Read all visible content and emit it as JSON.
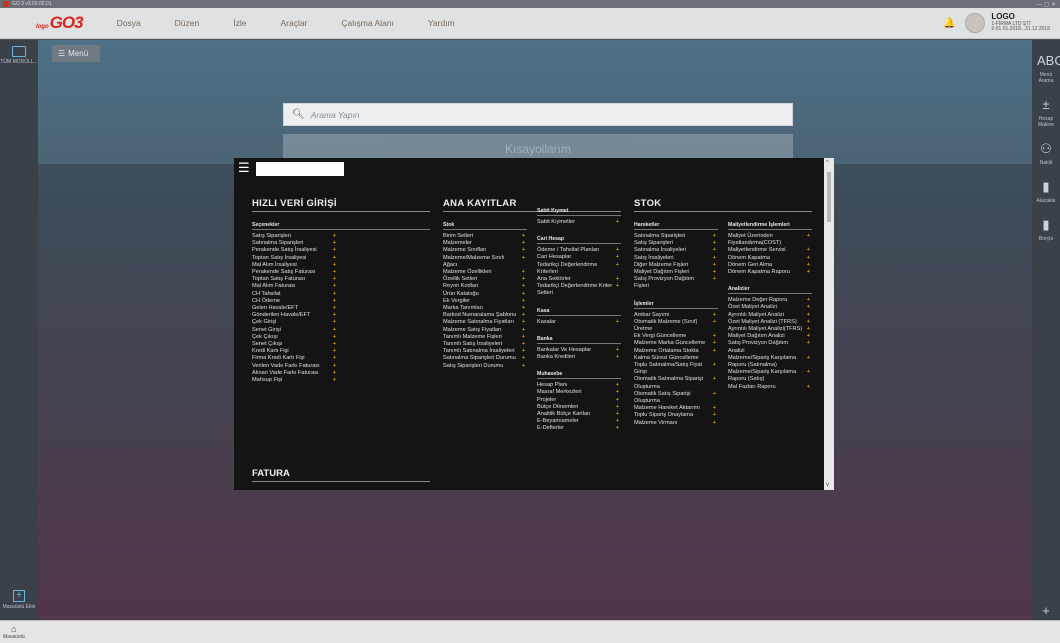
{
  "titlebar": {
    "text": "GO 3 v3.03.00.01"
  },
  "logo": {
    "small": "logo",
    "big": "GO3"
  },
  "menu": [
    "Dosya",
    "Düzen",
    "İzle",
    "Araçlar",
    "Çalışma Alanı",
    "Yardım"
  ],
  "company": {
    "name": "LOGO",
    "line1": "1-FİRMA LTD ŞTİ",
    "line2": "2-01.01.2018...31.12.2018"
  },
  "leftbar": {
    "top_label": "TÜM MODÜLL...",
    "bottom_label": "Masaüstü Ekle"
  },
  "rightbar": [
    {
      "glyph": "ABC",
      "label": "Menü Arama"
    },
    {
      "glyph": "±",
      "label": "Hesap Makine"
    },
    {
      "glyph": "⚇",
      "label": "Naklit"
    },
    {
      "glyph": "▮",
      "label": "Alacakla"
    },
    {
      "glyph": "▮",
      "label": "Borçla"
    },
    {
      "glyph": "+",
      "label": "Widget Ekle"
    }
  ],
  "menu_button": "Menü",
  "search": {
    "placeholder": "Arama Yapın"
  },
  "shortcuts": "Kısayollarım",
  "bottom": {
    "home": "Masaüstü"
  },
  "panel": {
    "col1": {
      "title": "HIZLI VERİ GİRİŞİ",
      "sub": "Seçenekler",
      "items": [
        "Satış Siparişleri",
        "Satınalma Siparişleri",
        "Perakende Satış İrsaliyesi",
        "Toptan Satış İrsaliyesi",
        "Mal Alım İrsaliyesi",
        "Perakende Satış Faturası",
        "Toptan Satış Faturası",
        "Mal Alım Faturası",
        "CH Tahsilat",
        "CH Ödeme",
        "Gelen Havale/EFT",
        "Gönderilen Havale/EFT",
        "Çek Girişi",
        "Senet Girişi",
        "Çek Çıkışı",
        "Senet Çıkışı",
        "Kredi Kartı Fişi",
        "Firma Kredi Kartı Fişi",
        "Verilen Vade Farkı Faturası",
        "Alınan Vade Farkı Faturası",
        "Mahsup Fişi"
      ],
      "footer": "FATURA"
    },
    "col2": {
      "title": "ANA KAYITLAR",
      "sub": "Stok",
      "items": [
        "Birim Setleri",
        "Malzemeler",
        "Malzeme Sınıfları",
        "Malzeme/Malzeme Sınıfı Ağacı",
        "Malzeme Özellikleri",
        "Özellik Setleri",
        "Reyon Kodları",
        "Ürün Kataloğu",
        "Ek Vergiler",
        "Marka Tanımları",
        "Barkod Numaralama Şablonu",
        "Malzeme Satınalma Fiyatları",
        "Malzeme Satış Fiyatları",
        "Tanımlı Malzeme Fişleri",
        "Tanımlı Satış İrsaliyeleri",
        "Tanımlı Satınalma İrsaliyeleri",
        "Satınalma Siparişleri Durumu",
        "Satış Siparişleri Durumu"
      ]
    },
    "col3": {
      "groups": [
        {
          "sub": "Sabit Kıymet",
          "items": [
            "Sabit Kıymetler"
          ]
        },
        {
          "sub": "Cari Hesap",
          "items": [
            "Ödeme / Tahsilat Planları",
            "Cari Hesaplar",
            "Tedarikçi Değerlendirme Kriterleri",
            "Ana Sektörler",
            "Tedarikçi Değerlendirme Kriter Setleri"
          ]
        },
        {
          "sub": "Kasa",
          "items": [
            "Kasalar"
          ]
        },
        {
          "sub": "Banka",
          "items": [
            "Bankalar Ve Hesaplar",
            "Banka Kredileri"
          ]
        },
        {
          "sub": "Muhasebe",
          "items": [
            "Hesap Planı",
            "Masraf Merkezleri",
            "Projeler",
            "Bütçe Dönemleri",
            "Analitik Bütçe Kartları",
            "E-Beyannameler",
            "E-Defterler"
          ]
        }
      ]
    },
    "col4": {
      "title": "STOK",
      "groups": [
        {
          "sub": "Hareketler",
          "items": [
            "Satınalma Siparişleri",
            "Satış Siparişleri",
            "Satınalma İrsaliyeleri",
            "Satış İrsaliyeleri",
            "Diğer Malzeme Fişleri",
            "Maliyet Dağıtım Fişleri",
            "Satış Provizyon Dağıtım Fişleri"
          ]
        },
        {
          "sub": "İşlemler",
          "items": [
            "Ambar Sayımı",
            "Otomatik Malzeme (Sınıf) Üretme",
            "Ek Vergi Güncelleme",
            "Malzeme Marka Güncelleme",
            "Malzeme Ortalama Stokta Kalma Süresi Güncelleme",
            "Toplu Satınalma/Satış Fiyat Girişi",
            "Otomatik Satınalma Siparişi Oluşturma",
            "Otomatik Satış Siparişi Oluşturma",
            "Malzeme Hareket Aktarımı",
            "Toplu Sipariş Onaylama",
            "Malzeme Virmanı"
          ]
        }
      ]
    },
    "col5": {
      "groups": [
        {
          "sub": "Maliyetlendirme İşlemleri",
          "items": [
            "Maliyet Üzerinden Fiyatlandırma(COST)",
            "Maliyetlendirme Servisi",
            "Dönem Kapatma",
            "Dönem Geri Alma",
            "Dönem Kapatma Raporu"
          ]
        },
        {
          "sub": "Analizler",
          "items": [
            "Malzeme Değer Raporu",
            "Özet Maliyet Analizi",
            "Ayrıntılı Maliyet Analizi",
            "Özet Maliyet Analizi (TFRS)",
            "Ayrıntılı Maliyet Analizi(TFRS)",
            "Maliyet Dağıtım Analizi",
            "Satış Provizyon Dağıtım Analizi",
            "Malzeme/Sipariş Karşılama Raporu (Satınalma)",
            "Malzeme/Sipariş Karşılama Raporu (Satış)",
            "Mal Fazları Raporu"
          ]
        }
      ]
    }
  }
}
